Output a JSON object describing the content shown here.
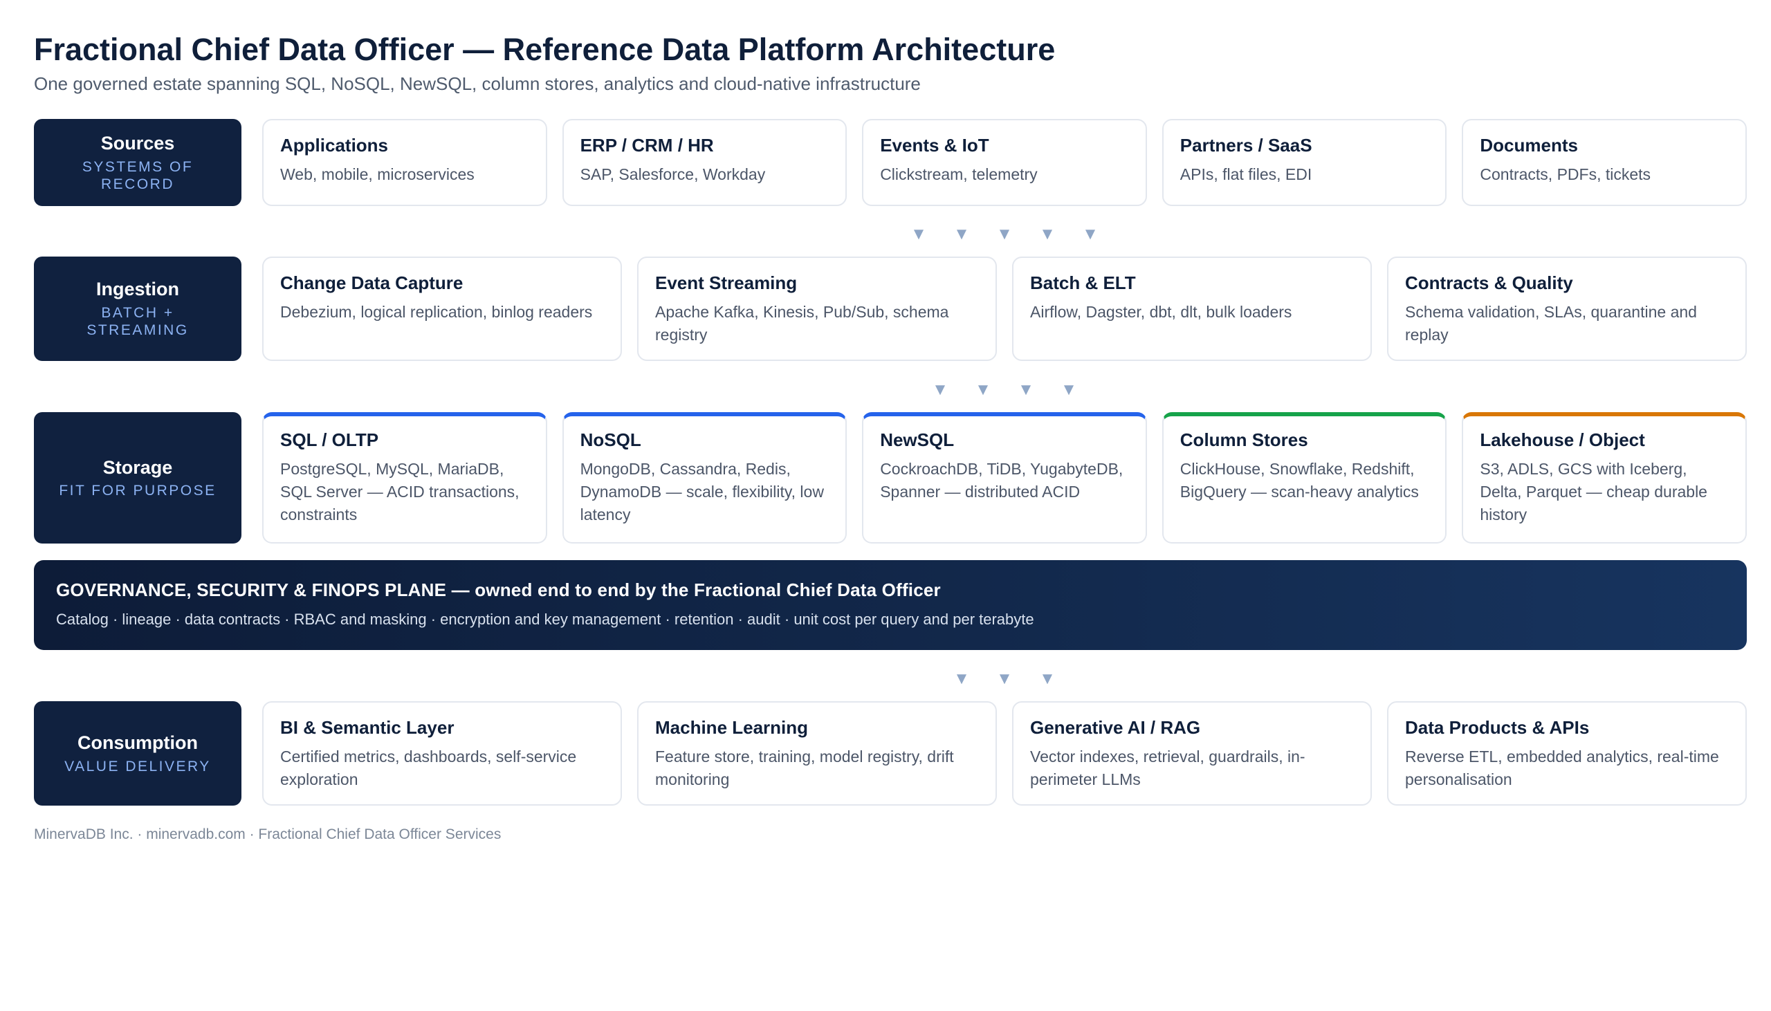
{
  "header": {
    "title": "Fractional Chief Data Officer — Reference Data Platform Architecture",
    "subtitle": "One governed estate spanning SQL, NoSQL, NewSQL, column stores, analytics and cloud-native infrastructure"
  },
  "sources": {
    "label": "Sources",
    "sublabel": "Systems of record",
    "cards": [
      {
        "title": "Applications",
        "desc": "Web, mobile, microservices"
      },
      {
        "title": "ERP / CRM / HR",
        "desc": "SAP, Salesforce, Workday"
      },
      {
        "title": "Events & IoT",
        "desc": "Clickstream, telemetry"
      },
      {
        "title": "Partners / SaaS",
        "desc": "APIs, flat files, EDI"
      },
      {
        "title": "Documents",
        "desc": "Contracts, PDFs, tickets"
      }
    ]
  },
  "ingestion": {
    "label": "Ingestion",
    "sublabel": "Batch + streaming",
    "cards": [
      {
        "title": "Change Data Capture",
        "desc": "Debezium, logical replication, binlog readers"
      },
      {
        "title": "Event Streaming",
        "desc": "Apache Kafka, Kinesis, Pub/Sub, schema registry"
      },
      {
        "title": "Batch & ELT",
        "desc": "Airflow, Dagster, dbt, dlt, bulk loaders"
      },
      {
        "title": "Contracts & Quality",
        "desc": "Schema validation, SLAs, quarantine and replay"
      }
    ]
  },
  "storage": {
    "label": "Storage",
    "sublabel": "Fit for purpose",
    "cards": [
      {
        "title": "SQL / OLTP",
        "desc": "PostgreSQL, MySQL, MariaDB, SQL Server — ACID transactions, constraints",
        "accent": "#2563eb"
      },
      {
        "title": "NoSQL",
        "desc": "MongoDB, Cassandra, Redis, DynamoDB — scale, flexibility, low latency",
        "accent": "#2563eb"
      },
      {
        "title": "NewSQL",
        "desc": "CockroachDB, TiDB, YugabyteDB, Spanner — distributed ACID",
        "accent": "#2563eb"
      },
      {
        "title": "Column Stores",
        "desc": "ClickHouse, Snowflake, Redshift, BigQuery — scan-heavy analytics",
        "accent": "#16a34a"
      },
      {
        "title": "Lakehouse / Object",
        "desc": "S3, ADLS, GCS with Iceberg, Delta, Parquet — cheap durable history",
        "accent": "#d97706"
      }
    ]
  },
  "governance": {
    "title": "GOVERNANCE, SECURITY & FINOPS PLANE — owned end to end by the Fractional Chief Data Officer",
    "desc": "Catalog · lineage · data contracts · RBAC and masking · encryption and key management · retention · audit · unit cost per query and per terabyte"
  },
  "consumption": {
    "label": "Consumption",
    "sublabel": "Value delivery",
    "cards": [
      {
        "title": "BI & Semantic Layer",
        "desc": "Certified metrics, dashboards, self-service exploration"
      },
      {
        "title": "Machine Learning",
        "desc": "Feature store, training, model registry, drift monitoring"
      },
      {
        "title": "Generative AI / RAG",
        "desc": "Vector indexes, retrieval, guardrails, in-perimeter LLMs"
      },
      {
        "title": "Data Products & APIs",
        "desc": "Reverse ETL, embedded analytics, real-time personalisation"
      }
    ]
  },
  "arrows": {
    "glyph": "▼",
    "after_sources": 5,
    "after_ingestion": 4,
    "after_governance": 3
  },
  "footer": {
    "text": "MinervaDB Inc. · minervadb.com · Fractional Chief Data Officer Services"
  }
}
